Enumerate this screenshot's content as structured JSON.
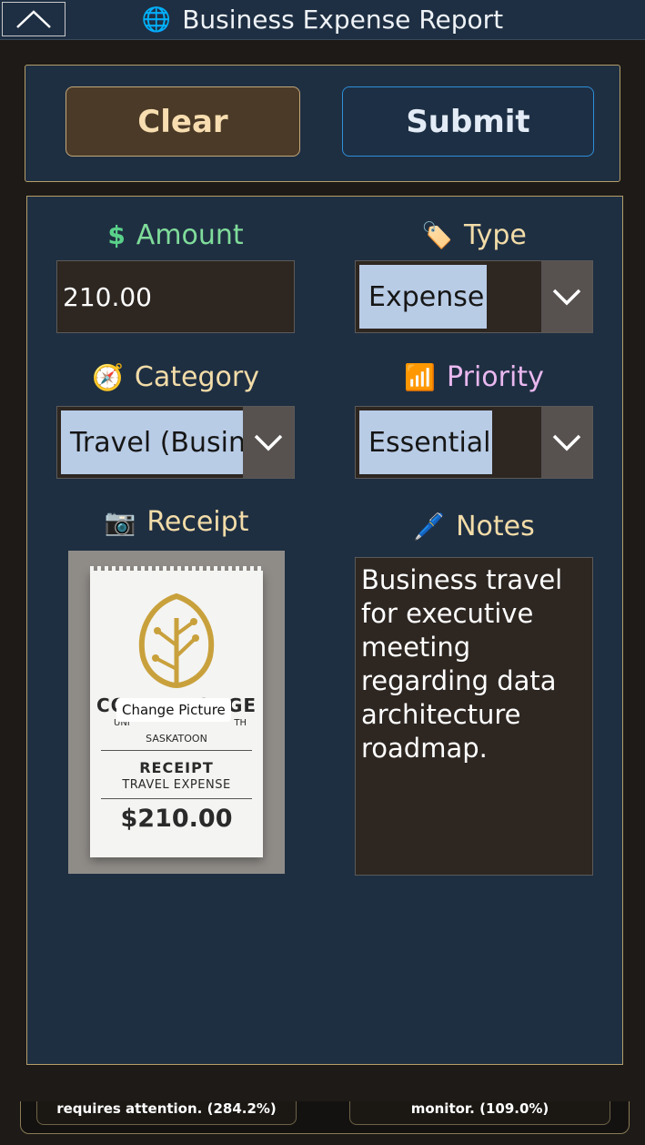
{
  "header": {
    "title": "Business Expense Report",
    "globe_icon": "🌐"
  },
  "buttons": {
    "clear_label": "Clear",
    "submit_label": "Submit"
  },
  "fields": {
    "amount": {
      "label": "Amount",
      "icon": "$",
      "value": "210.00",
      "label_color": "#7fdc9a"
    },
    "type": {
      "label": "Type",
      "icon": "🏷️",
      "value": "Expense",
      "label_color": "#f2dca8"
    },
    "category": {
      "label": "Category",
      "icon": "🧭",
      "value": "Travel (Business)",
      "label_color": "#f2dca8"
    },
    "priority": {
      "label": "Priority",
      "icon": "📶",
      "value": "Essential",
      "label_color": "#e9b8ef"
    },
    "receipt": {
      "label": "Receipt",
      "icon": "📷",
      "change_label": "Change Picture",
      "paper": {
        "brand": "CORTEXFORGE",
        "sub": "UNI",
        "sub_right": "TH",
        "city": "SASKATOON",
        "heading": "RECEIPT",
        "kind": "TRAVEL EXPENSE",
        "total": "$210.00"
      }
    },
    "notes": {
      "label": "Notes",
      "icon": "🖊️",
      "value": "Business travel for executive meeting regarding data architecture roadmap."
    }
  },
  "background": {
    "left_text": "requires attention. (284.2%)",
    "right_text": "monitor. (109.0%)"
  }
}
